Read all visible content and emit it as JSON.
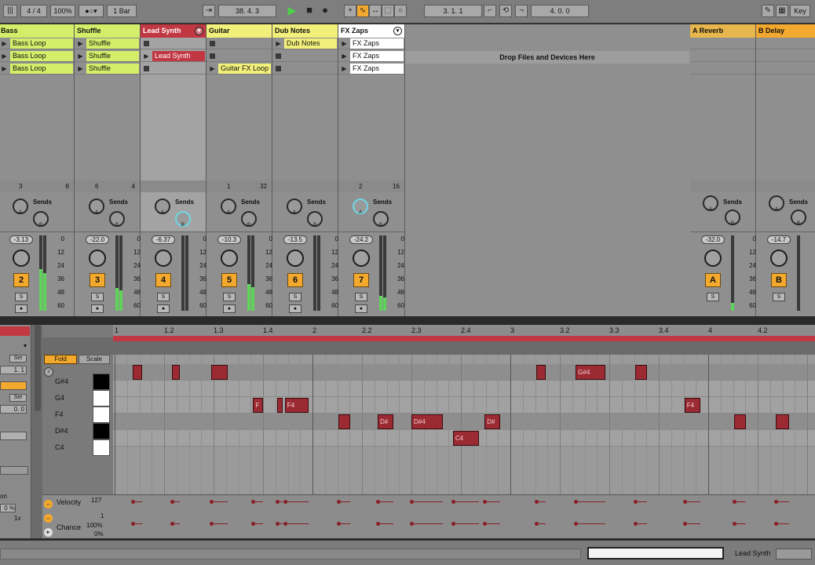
{
  "transport": {
    "tap_icon": "metronome-bars-icon",
    "signature": "4 / 4",
    "zoom": "100%",
    "quantize": "1 Bar",
    "position": "38.  4.  3",
    "loop_start": "3.  1.  1",
    "loop_length": "4.  0.  0",
    "key_label": "Key"
  },
  "tracks": [
    {
      "name": "Bass",
      "color": "#d4ee6a",
      "clips": [
        "Bass Loop",
        "Bass Loop",
        "Bass Loop"
      ],
      "stop_num": "3",
      "stop_num2": "8",
      "sends": "Sends",
      "volume": "-3.13",
      "number": "2",
      "meter": 0.55
    },
    {
      "name": "Shuffle",
      "color": "#d4ee6a",
      "clips": [
        "Shuffle",
        "Shuffle",
        "Shuffle"
      ],
      "stop_num": "6",
      "stop_num2": "4",
      "sends": "Sends",
      "volume": "-22.0",
      "number": "3",
      "meter": 0.3
    },
    {
      "name": "Lead Synth",
      "color": "#c13742",
      "clips": [
        "",
        "Lead Synth",
        ""
      ],
      "stop_num": "",
      "stop_num2": "",
      "sends": "Sends",
      "volume": "-6.37",
      "number": "4",
      "meter": 0.0
    },
    {
      "name": "Guitar",
      "color": "#f2f07a",
      "clips": [
        "",
        "",
        "Guitar FX Loop"
      ],
      "stop_num": "1",
      "stop_num2": "32",
      "sends": "Sends",
      "volume": "-10.3",
      "number": "5",
      "meter": 0.35
    },
    {
      "name": "Dub Notes",
      "color": "#f2f07a",
      "clips": [
        "Dub Notes",
        "",
        ""
      ],
      "stop_num": "",
      "stop_num2": "",
      "sends": "Sends",
      "volume": "-13.5",
      "number": "6",
      "meter": 0.0
    },
    {
      "name": "FX Zaps",
      "color": "#ffffff",
      "clips": [
        "FX Zaps",
        "FX Zaps",
        "FX Zaps"
      ],
      "stop_num": "2",
      "stop_num2": "16",
      "sends": "Sends",
      "volume": "-24.2",
      "number": "7",
      "meter": 0.2
    }
  ],
  "drop_zone": "Drop Files and Devices Here",
  "returns": [
    {
      "name": "A Reverb",
      "color": "#e7b64c",
      "sends": "Sends",
      "volume": "-32.0",
      "number": "A",
      "meter": 0.1
    },
    {
      "name": "B Delay",
      "color": "#f3a82e",
      "sends": "Sends",
      "volume": "-14.7",
      "number": "B",
      "meter": 0.0
    }
  ],
  "meter_scale": [
    "0",
    "12",
    "24",
    "36",
    "48",
    "60"
  ],
  "mixer_labels": {
    "solo": "S",
    "knob_a": "A",
    "knob_b": "B"
  },
  "editor": {
    "fold": "Fold",
    "scale": "Scale",
    "set1": "Set",
    "set2": "Set",
    "val1": "1.  1",
    "val2": "0.  0",
    "pct": "0 %",
    "mult": "1x",
    "on": "on",
    "ruler": [
      "1",
      "1.2",
      "1.3",
      "1.4",
      "2",
      "2.2",
      "2.3",
      "2.4",
      "3",
      "3.2",
      "3.3",
      "3.4",
      "4",
      "4.2",
      "4."
    ],
    "keys": [
      {
        "label": "G#4",
        "black": true
      },
      {
        "label": "G4",
        "black": false
      },
      {
        "label": "F4",
        "black": false
      },
      {
        "label": "D#4",
        "black": true
      },
      {
        "label": "C4",
        "black": false
      }
    ],
    "notes": [
      {
        "row": 0,
        "start": 1.09,
        "len": 0.05,
        "text": ""
      },
      {
        "row": 0,
        "start": 1.29,
        "len": 0.04,
        "text": ""
      },
      {
        "row": 0,
        "start": 1.49,
        "len": 0.08,
        "text": ""
      },
      {
        "row": 2,
        "start": 1.7,
        "len": 0.05,
        "text": "F"
      },
      {
        "row": 2,
        "start": 1.82,
        "len": 0.03,
        "text": ""
      },
      {
        "row": 2,
        "start": 1.86,
        "len": 0.12,
        "text": "F4"
      },
      {
        "row": 3,
        "start": 2.13,
        "len": 0.06,
        "text": ""
      },
      {
        "row": 3,
        "start": 2.33,
        "len": 0.08,
        "text": "D#"
      },
      {
        "row": 3,
        "start": 2.5,
        "len": 0.16,
        "text": "D#4"
      },
      {
        "row": 4,
        "start": 2.71,
        "len": 0.13,
        "text": "C4"
      },
      {
        "row": 3,
        "start": 2.87,
        "len": 0.08,
        "text": "D#"
      },
      {
        "row": 0,
        "start": 3.13,
        "len": 0.05,
        "text": ""
      },
      {
        "row": 0,
        "start": 3.33,
        "len": 0.15,
        "text": "G#4"
      },
      {
        "row": 0,
        "start": 3.63,
        "len": 0.06,
        "text": ""
      },
      {
        "row": 2,
        "start": 3.88,
        "len": 0.08,
        "text": "F4"
      },
      {
        "row": 3,
        "start": 4.13,
        "len": 0.06,
        "text": ""
      },
      {
        "row": 3,
        "start": 4.34,
        "len": 0.07,
        "text": ""
      }
    ],
    "velocity_label": "Velocity",
    "velocity_max": "127",
    "velocity_min": "1",
    "chance_label": "Chance",
    "chance_max": "100%",
    "chance_min": "0%"
  },
  "status": {
    "track": "Lead Synth"
  }
}
